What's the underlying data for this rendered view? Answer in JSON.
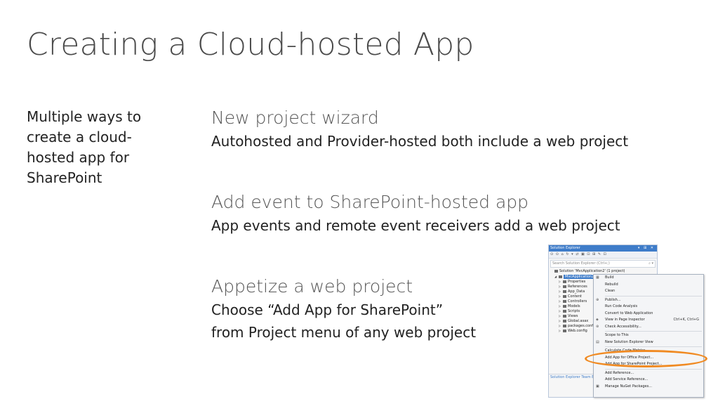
{
  "slide": {
    "title": "Creating a Cloud-hosted App",
    "summary": "Multiple ways to create a cloud-hosted app for SharePoint",
    "points": [
      {
        "heading": "New project wizard",
        "lines": [
          "Autohosted and Provider-hosted both include a web project"
        ]
      },
      {
        "heading": "Add event to SharePoint-hosted app",
        "lines": [
          "App events and remote event receivers add a web project"
        ]
      },
      {
        "heading": "Appetize a web project",
        "lines": [
          "Choose “Add App for SharePoint”",
          "from Project menu of any web project"
        ]
      }
    ]
  },
  "screenshot": {
    "panel_title": "Solution Explorer",
    "panel_controls": "▾ ⊞ ✕",
    "toolbar_glyphs": "⊙ ⊙ ⌂ ↻ ▾ ⇄ ▣ ⊡ ⊞ ✎ ⊡",
    "search_placeholder": "Search Solution Explorer (Ctrl+;)",
    "search_glyph": "⌕ ▾",
    "tree": [
      {
        "label": "Solution 'MvcApplication2' (1 project)",
        "indent": 0,
        "selected": false
      },
      {
        "label": "MvcApplication2",
        "indent": 1,
        "selected": true
      },
      {
        "label": "Properties",
        "indent": 2,
        "selected": false
      },
      {
        "label": "References",
        "indent": 2,
        "selected": false
      },
      {
        "label": "App_Data",
        "indent": 2,
        "selected": false
      },
      {
        "label": "Content",
        "indent": 2,
        "selected": false
      },
      {
        "label": "Controllers",
        "indent": 2,
        "selected": false
      },
      {
        "label": "Models",
        "indent": 2,
        "selected": false
      },
      {
        "label": "Scripts",
        "indent": 2,
        "selected": false
      },
      {
        "label": "Views",
        "indent": 2,
        "selected": false
      },
      {
        "label": "Global.asax",
        "indent": 2,
        "selected": false
      },
      {
        "label": "packages.config",
        "indent": 2,
        "selected": false
      },
      {
        "label": "Web.config",
        "indent": 2,
        "selected": false
      }
    ],
    "bottom_tabs": "Solution Explorer   Team Explorer",
    "menu_items": [
      {
        "label": "Build",
        "shortcut": "",
        "icon": "▦"
      },
      {
        "label": "Rebuild",
        "shortcut": "",
        "icon": ""
      },
      {
        "label": "Clean",
        "shortcut": "",
        "icon": ""
      },
      {
        "label": "Publish...",
        "shortcut": "",
        "icon": "⊕"
      },
      {
        "label": "Run Code Analysis",
        "shortcut": "",
        "icon": ""
      },
      {
        "label": "Convert to Web Application",
        "shortcut": "",
        "icon": ""
      },
      {
        "label": "View in Page Inspector",
        "shortcut": "Ctrl+K, Ctrl+G",
        "icon": "◈"
      },
      {
        "label": "Check Accessibility...",
        "shortcut": "",
        "icon": "⊛"
      },
      {
        "label": "Scope to This",
        "shortcut": "",
        "icon": ""
      },
      {
        "label": "New Solution Explorer View",
        "shortcut": "",
        "icon": "▤"
      },
      {
        "label": "Calculate Code Metrics",
        "shortcut": "",
        "icon": ""
      },
      {
        "label": "Add App for Office Project...",
        "shortcut": "",
        "icon": ""
      },
      {
        "label": "Add App for SharePoint Project...",
        "shortcut": "",
        "icon": ""
      },
      {
        "label": "Add Reference...",
        "shortcut": "",
        "icon": ""
      },
      {
        "label": "Add Service Reference...",
        "shortcut": "",
        "icon": ""
      },
      {
        "label": "Manage NuGet Packages...",
        "shortcut": "",
        "icon": "▣"
      }
    ],
    "highlight_color": "#f08a22",
    "accent_color": "#3e7cc9"
  }
}
